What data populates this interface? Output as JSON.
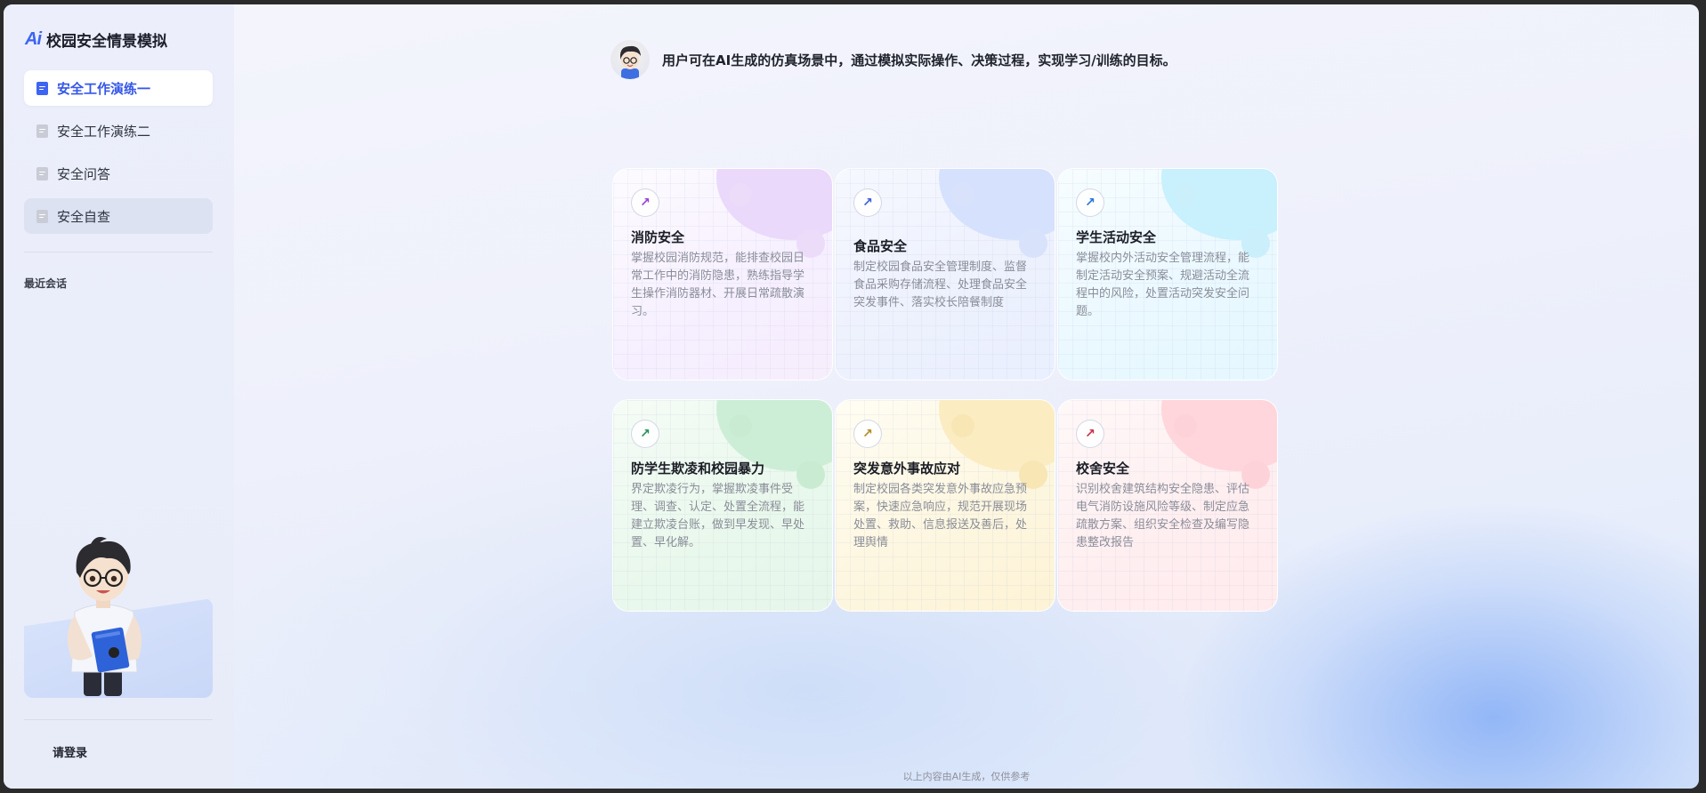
{
  "app": {
    "logo_text": "Ai",
    "title": "校园安全情景模拟"
  },
  "sidebar": {
    "items": [
      {
        "label": "安全工作演练一",
        "state": "active",
        "icon": "document-icon"
      },
      {
        "label": "安全工作演练二",
        "state": "normal",
        "icon": "document-icon"
      },
      {
        "label": "安全问答",
        "state": "normal",
        "icon": "document-icon"
      },
      {
        "label": "安全自查",
        "state": "hover",
        "icon": "document-icon"
      }
    ],
    "recent_label": "最近会话",
    "login_label": "请登录"
  },
  "header": {
    "text": "用户可在AI生成的仿真场景中，通过模拟实际操作、决策过程，实现学习/训练的目标。"
  },
  "cards": [
    {
      "title": "消防安全",
      "desc": "掌握校园消防规范，能排查校园日常工作中的消防隐患，熟练指导学生操作消防器材、开展日常疏散演习。",
      "accent": "#9b3fd8"
    },
    {
      "title": "食品安全",
      "desc": "制定校园食品安全管理制度、监督食品采购存储流程、处理食品安全突发事件、落实校长陪餐制度",
      "accent": "#3d5fd8"
    },
    {
      "title": "学生活动安全",
      "desc": "掌握校内外活动安全管理流程，能制定活动安全预案、规避活动全流程中的风险，处置活动突发安全问题。",
      "accent": "#2a74d8"
    },
    {
      "title": "防学生欺凌和校园暴力",
      "desc": "界定欺凌行为，掌握欺凌事件受理、调查、认定、处置全流程，能建立欺凌台账，做到早发现、早处置、早化解。",
      "accent": "#2c8f5c"
    },
    {
      "title": "突发意外事故应对",
      "desc": "制定校园各类突发意外事故应急预案，快速应急响应，规范开展现场处置、救助、信息报送及善后，处理舆情",
      "accent": "#b6892a"
    },
    {
      "title": "校舍安全",
      "desc": "识别校舍建筑结构安全隐患、评估电气消防设施风险等级、制定应急疏散方案、组织安全检查及编写隐患整改报告",
      "accent": "#c9314b"
    }
  ],
  "card_icon": "arrow-up-right-icon",
  "footer_note": "以上内容由AI生成，仅供参考"
}
